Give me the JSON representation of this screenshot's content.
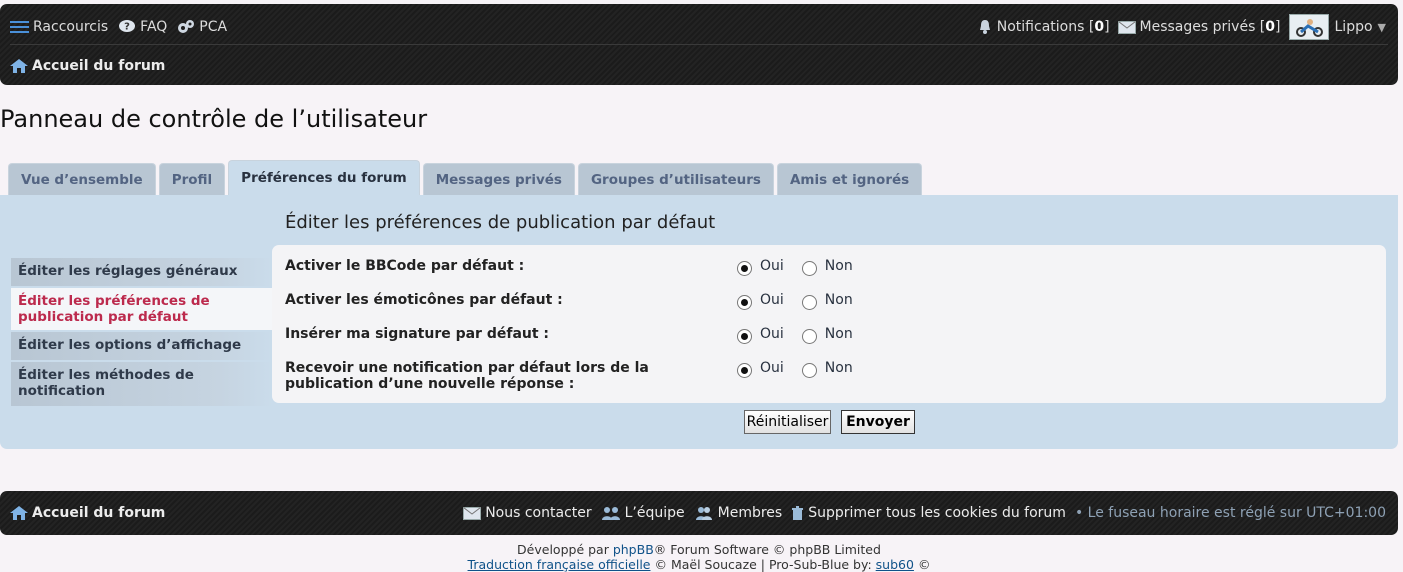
{
  "topbar": {
    "shortcuts": "Raccourcis",
    "faq": "FAQ",
    "pca": "PCA",
    "notifications_label": "Notifications",
    "notifications_count": "0",
    "pm_label": "Messages privés",
    "pm_count": "0",
    "username": "Lippo",
    "forum_home": "Accueil du forum"
  },
  "page_title": "Panneau de contrôle de l’utilisateur",
  "tabs": [
    {
      "label": "Vue d’ensemble"
    },
    {
      "label": "Profil"
    },
    {
      "label": "Préférences du forum"
    },
    {
      "label": "Messages privés"
    },
    {
      "label": "Groupes d’utilisateurs"
    },
    {
      "label": "Amis et ignorés"
    }
  ],
  "sidebar": {
    "items": [
      {
        "label": "Éditer les réglages généraux"
      },
      {
        "label": "Éditer les préférences de publication par défaut"
      },
      {
        "label": "Éditer les options d’affichage"
      },
      {
        "label": "Éditer les méthodes de notification"
      }
    ]
  },
  "form": {
    "title": "Éditer les préférences de publication par défaut",
    "yes": "Oui",
    "no": "Non",
    "rows": [
      {
        "label": "Activer le BBCode par défaut :",
        "value": "Oui"
      },
      {
        "label": "Activer les émoticônes par défaut :",
        "value": "Oui"
      },
      {
        "label": "Insérer ma signature par défaut :",
        "value": "Oui"
      },
      {
        "label": "Recevoir une notification par défaut lors de la publication d’une nouvelle réponse :",
        "value": "Oui"
      }
    ],
    "reset_label": "Réinitialiser",
    "submit_label": "Envoyer"
  },
  "footer": {
    "forum_home": "Accueil du forum",
    "contact": "Nous contacter",
    "team": "L’équipe",
    "members": "Membres",
    "delete_cookies": "Supprimer tous les cookies du forum",
    "timezone": "• Le fuseau horaire est réglé sur UTC+01:00",
    "credit_prefix": "Développé par",
    "credit_phpbb": "phpBB",
    "credit_suffix": "® Forum Software © phpBB Limited",
    "credit_line2_link1": "Traduction française officielle",
    "credit_line2_mid": "© Maël Soucaze | Pro-Sub-Blue by:",
    "credit_line2_link2": "sub60",
    "credit_line2_end": "©"
  },
  "colors": {
    "accent_active_sidebar": "#bc2a4d",
    "panel_bg": "#cadceb",
    "tab_bg": "#b8c6d3",
    "bar_bg": "#1e1e1e",
    "link": "#105289"
  }
}
